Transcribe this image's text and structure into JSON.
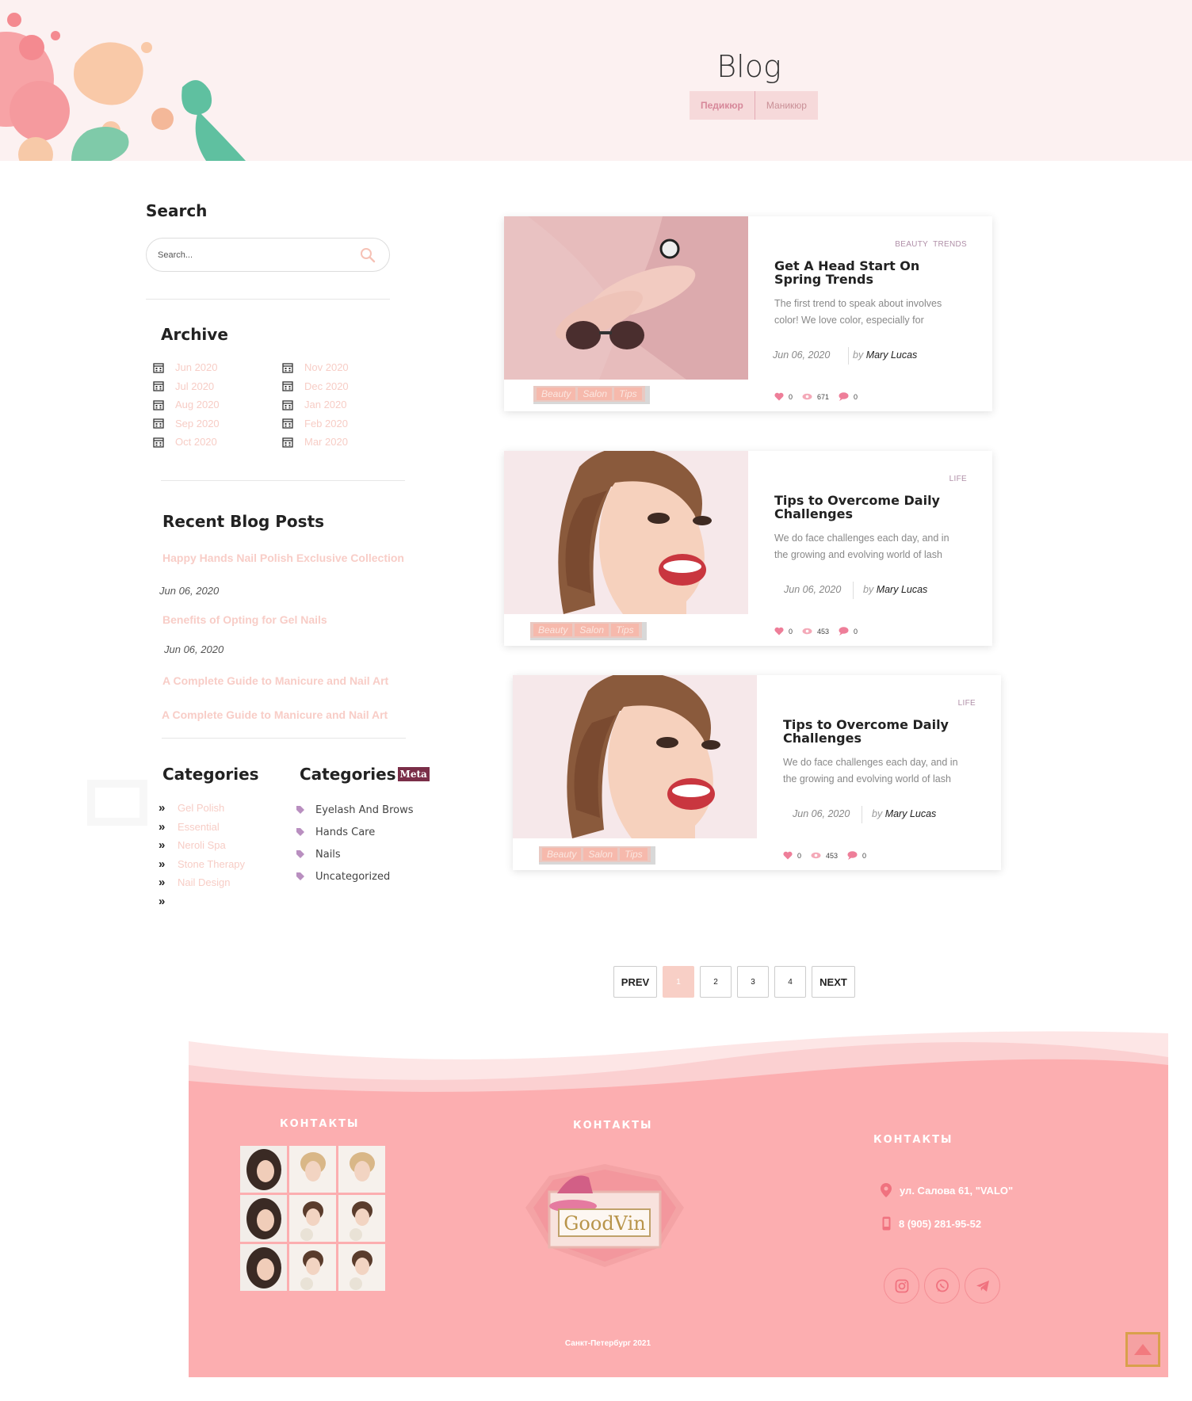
{
  "hero": {
    "title": "Blog",
    "tabs": [
      "Педикюр",
      "Маникюр"
    ]
  },
  "sidebar": {
    "search": {
      "title": "Search",
      "placeholder": "Search..."
    },
    "archive": {
      "title": "Archive",
      "col1": [
        "Jun 2020",
        "Jul 2020",
        "Aug 2020",
        "Sep 2020",
        "Oct 2020"
      ],
      "col2": [
        "Nov 2020",
        "Dec 2020",
        "Jan 2020",
        "Feb 2020",
        "Mar 2020"
      ]
    },
    "recent": {
      "title": "Recent Blog Posts",
      "items": [
        {
          "title": "Happy Hands Nail Polish Exclusive Collection",
          "date": "Jun 06, 2020"
        },
        {
          "title": "Benefits of Opting for Gel Nails",
          "date": "Jun 06, 2020"
        },
        {
          "title": "A Complete Guide to Manicure and Nail Art"
        },
        {
          "title": "A Complete Guide to Manicure and Nail Art"
        }
      ]
    },
    "categories": {
      "title": "Categories",
      "items": [
        "Gel Polish",
        "Essential",
        "Neroli Spa",
        "Stone Therapy",
        "Nail Design",
        ""
      ]
    },
    "categories_meta": {
      "title": "Categories",
      "badge": "Meta",
      "items": [
        "Eyelash And Brows",
        "Hands Care",
        "Nails",
        "Uncategorized"
      ]
    }
  },
  "posts": [
    {
      "cats": [
        "BEAUTY",
        "TRENDS"
      ],
      "title": "Get A Head Start On Spring Trends",
      "excerpt": "The first trend to speak about involves color! We love color, especially for",
      "date": "Jun 06, 2020",
      "by": "by",
      "author": "Mary Lucas",
      "tags": [
        "Beauty",
        "Salon",
        "Tips"
      ],
      "likes": "0",
      "views": "671",
      "comments": "0"
    },
    {
      "cats": [
        "LIFE"
      ],
      "title": "Tips to Overcome Daily Challenges",
      "excerpt": "We do face challenges each day, and in the growing and evolving world of lash",
      "date": "Jun 06, 2020",
      "by": "by",
      "author": "Mary Lucas",
      "tags": [
        "Beauty",
        "Salon",
        "Tips"
      ],
      "likes": "0",
      "views": "453",
      "comments": "0"
    },
    {
      "cats": [
        "LIFE"
      ],
      "title": "Tips to Overcome Daily Challenges",
      "excerpt": "We do face challenges each day, and in the growing and evolving world of lash",
      "date": "Jun 06, 2020",
      "by": "by",
      "author": "Mary Lucas",
      "tags": [
        "Beauty",
        "Salon",
        "Tips"
      ],
      "likes": "0",
      "views": "453",
      "comments": "0"
    }
  ],
  "pagination": {
    "prev": "PREV",
    "pages": [
      "1",
      "2",
      "3",
      "4"
    ],
    "active": "1",
    "next": "NEXT"
  },
  "footer": {
    "col1_title": "КОНТАКТЫ",
    "col2_title": "КОНТАКТЫ",
    "col3_title": "КОНТАКТЫ",
    "logo_text": "GoodVin",
    "address": "ул. Салова 61, \"VALO\"",
    "phone": "8 (905) 281-95-52",
    "social_icons": [
      "instagram-icon",
      "whatsapp-icon",
      "telegram-icon"
    ],
    "copyright": "Санкт-Петербург 2021"
  },
  "colors": {
    "accent_pink": "#f8cdc7",
    "footer_pink": "#fcaeb0",
    "meta_badge": "#7a2e48",
    "hero_bg": "#fcf1f1"
  }
}
